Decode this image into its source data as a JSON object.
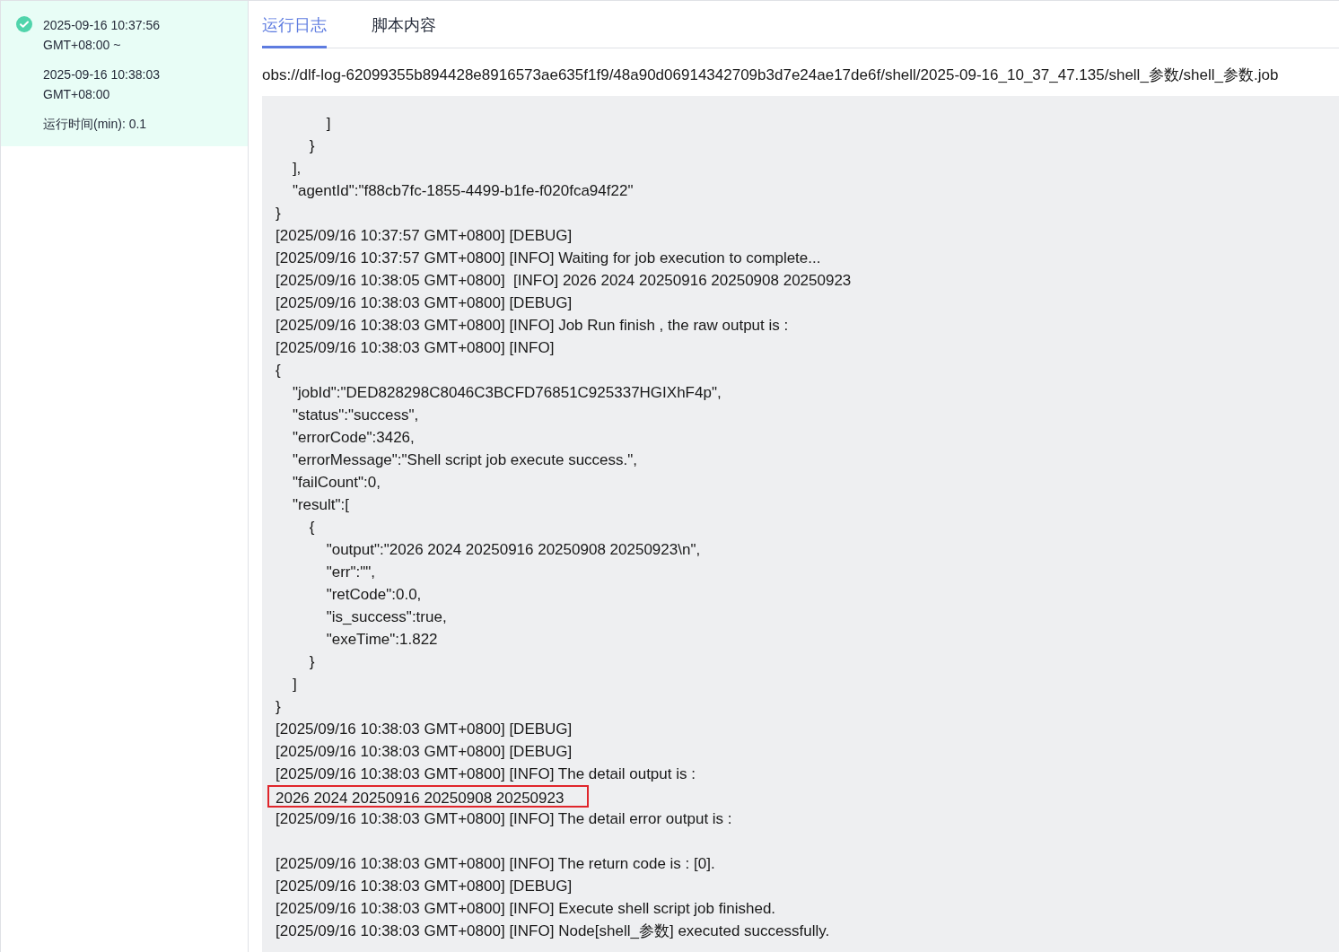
{
  "run_summary": {
    "succeeded": true,
    "start": "2025-09-16 10:37:56",
    "start_tz": "GMT+08:00 ~",
    "end": "2025-09-16 10:38:03",
    "end_tz": "GMT+08:00",
    "duration": "运行时间(min): 0.1"
  },
  "tabs": [
    {
      "label": "运行日志",
      "selected": true
    },
    {
      "label": "脚本内容",
      "selected": false
    }
  ],
  "log_path": "obs://dlf-log-62099355b894428e8916573ae635f1f9/48a90d06914342709b3d7e24ae17de6f/shell/2025-09-16_10_37_47.135/shell_参数/shell_参数.job",
  "log_lines": [
    {
      "kind": "text",
      "text": "            ]",
      "highlighted": false
    },
    {
      "kind": "text",
      "text": "        }",
      "highlighted": false
    },
    {
      "kind": "text",
      "text": "    ],",
      "highlighted": false
    },
    {
      "kind": "text",
      "text": "    \"agentId\":\"f88cb7fc-1855-4499-b1fe-f020fca94f22\"",
      "highlighted": false
    },
    {
      "kind": "text",
      "text": "}",
      "highlighted": false
    },
    {
      "kind": "text",
      "text": "[2025/09/16 10:37:57 GMT+0800] [DEBUG]",
      "highlighted": false
    },
    {
      "kind": "text",
      "text": "[2025/09/16 10:37:57 GMT+0800] [INFO] Waiting for job execution to complete...",
      "highlighted": false
    },
    {
      "kind": "text",
      "text": "[2025/09/16 10:38:05 GMT+0800]  [INFO] 2026 2024 20250916 20250908 20250923",
      "highlighted": false
    },
    {
      "kind": "text",
      "text": "[2025/09/16 10:38:03 GMT+0800] [DEBUG]",
      "highlighted": false
    },
    {
      "kind": "text",
      "text": "[2025/09/16 10:38:03 GMT+0800] [INFO] Job Run finish , the raw output is :",
      "highlighted": false
    },
    {
      "kind": "text",
      "text": "[2025/09/16 10:38:03 GMT+0800] [INFO]",
      "highlighted": false
    },
    {
      "kind": "text",
      "text": "{",
      "highlighted": false
    },
    {
      "kind": "text",
      "text": "    \"jobId\":\"DED828298C8046C3BCFD76851C925337HGIXhF4p\",",
      "highlighted": false
    },
    {
      "kind": "text",
      "text": "    \"status\":\"success\",",
      "highlighted": false
    },
    {
      "kind": "text",
      "text": "    \"errorCode\":3426,",
      "highlighted": false
    },
    {
      "kind": "text",
      "text": "    \"errorMessage\":\"Shell script job execute success.\",",
      "highlighted": false
    },
    {
      "kind": "text",
      "text": "    \"failCount\":0,",
      "highlighted": false
    },
    {
      "kind": "text",
      "text": "    \"result\":[",
      "highlighted": false
    },
    {
      "kind": "text",
      "text": "        {",
      "highlighted": false
    },
    {
      "kind": "text",
      "text": "            \"output\":\"2026 2024 20250916 20250908 20250923\\n\",",
      "highlighted": false
    },
    {
      "kind": "text",
      "text": "            \"err\":\"\",",
      "highlighted": false
    },
    {
      "kind": "text",
      "text": "            \"retCode\":0.0,",
      "highlighted": false
    },
    {
      "kind": "text",
      "text": "            \"is_success\":true,",
      "highlighted": false
    },
    {
      "kind": "text",
      "text": "            \"exeTime\":1.822",
      "highlighted": false
    },
    {
      "kind": "text",
      "text": "        }",
      "highlighted": false
    },
    {
      "kind": "text",
      "text": "    ]",
      "highlighted": false
    },
    {
      "kind": "text",
      "text": "}",
      "highlighted": false
    },
    {
      "kind": "text",
      "text": "[2025/09/16 10:38:03 GMT+0800] [DEBUG]",
      "highlighted": false
    },
    {
      "kind": "text",
      "text": "[2025/09/16 10:38:03 GMT+0800] [DEBUG]",
      "highlighted": false
    },
    {
      "kind": "text",
      "text": "[2025/09/16 10:38:03 GMT+0800] [INFO] The detail output is :",
      "highlighted": false
    },
    {
      "kind": "text",
      "text": "2026 2024 20250916 20250908 20250923",
      "highlighted": true
    },
    {
      "kind": "text",
      "text": "[2025/09/16 10:38:03 GMT+0800] [INFO] The detail error output is :",
      "highlighted": false
    },
    {
      "kind": "blank"
    },
    {
      "kind": "text",
      "text": "[2025/09/16 10:38:03 GMT+0800] [INFO] The return code is : [0].",
      "highlighted": false
    },
    {
      "kind": "text",
      "text": "[2025/09/16 10:38:03 GMT+0800] [DEBUG]",
      "highlighted": false
    },
    {
      "kind": "text",
      "text": "[2025/09/16 10:38:03 GMT+0800] [INFO] Execute shell script job finished.",
      "highlighted": false
    },
    {
      "kind": "text",
      "text": "[2025/09/16 10:38:03 GMT+0800] [INFO] Node[shell_参数] executed successfully.",
      "highlighted": false
    }
  ]
}
